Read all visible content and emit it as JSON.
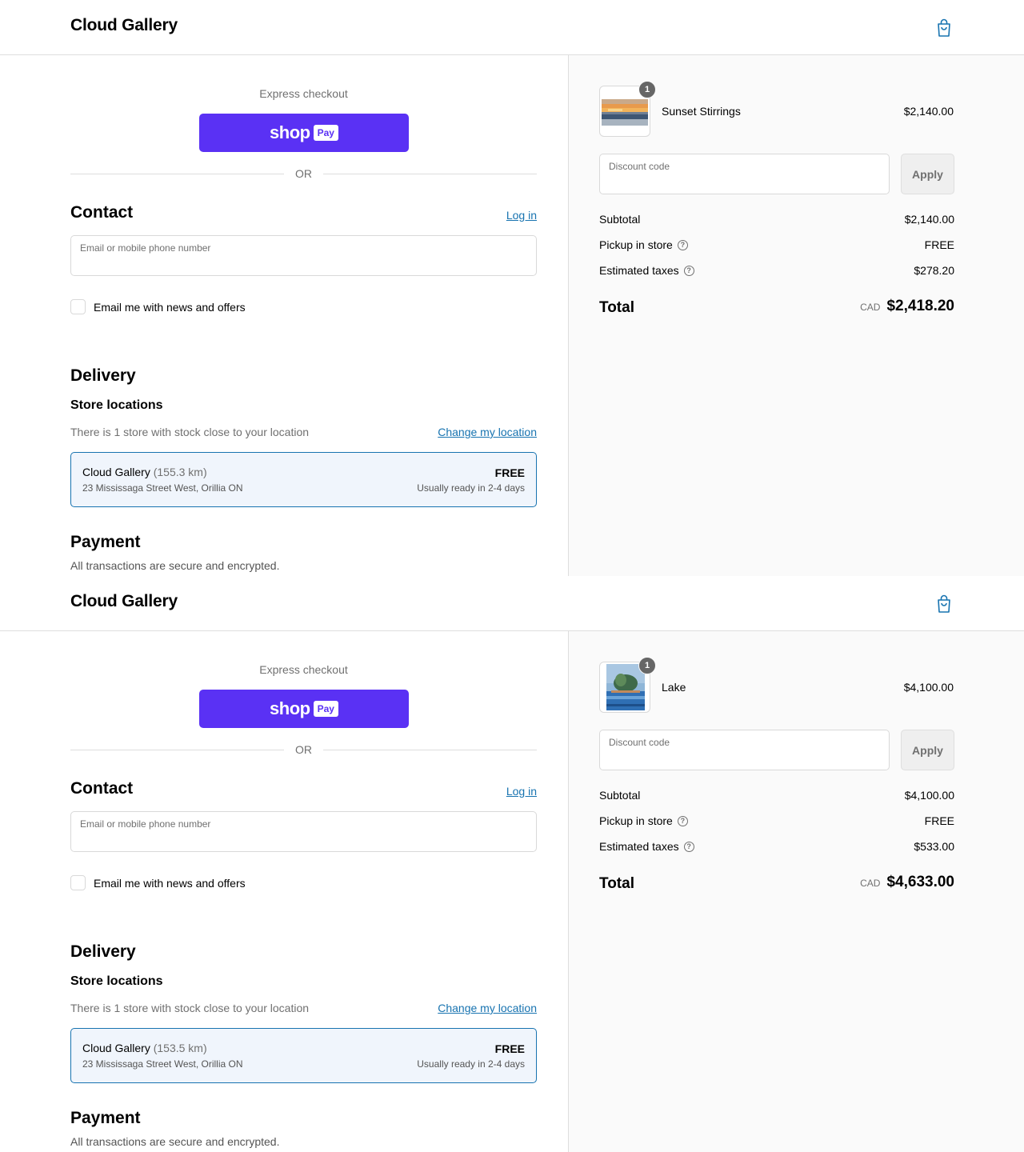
{
  "frames": [
    {
      "brand": "Cloud Gallery",
      "express_label": "Express checkout",
      "shop_word": "shop",
      "shop_pay": "Pay",
      "or_text": "OR",
      "contact": {
        "title": "Contact",
        "login_link": "Log in",
        "email_label": "Email or mobile phone number",
        "email_value": "",
        "newsletter_label": "Email me with news and offers",
        "newsletter_checked": false
      },
      "delivery": {
        "title": "Delivery",
        "subtitle": "Store locations",
        "stock_note": "There is 1 store with stock close to your location",
        "change_location": "Change my location",
        "store": {
          "name": "Cloud Gallery",
          "distance": "(155.3 km)",
          "address": "23 Mississaga Street West, Orillia ON",
          "price": "FREE",
          "ready": "Usually ready in 2-4 days"
        }
      },
      "payment": {
        "title": "Payment",
        "note": "All transactions are secure and encrypted."
      },
      "summary": {
        "item_name": "Sunset Stirrings",
        "item_qty": "1",
        "item_price": "$2,140.00",
        "discount_label": "Discount code",
        "apply_label": "Apply",
        "subtotal_label": "Subtotal",
        "subtotal_value": "$2,140.00",
        "pickup_label": "Pickup in store",
        "pickup_value": "FREE",
        "taxes_label": "Estimated taxes",
        "taxes_value": "$278.20",
        "total_label": "Total",
        "currency": "CAD",
        "total_value": "$2,418.20"
      }
    },
    {
      "brand": "Cloud Gallery",
      "express_label": "Express checkout",
      "shop_word": "shop",
      "shop_pay": "Pay",
      "or_text": "OR",
      "contact": {
        "title": "Contact",
        "login_link": "Log in",
        "email_label": "Email or mobile phone number",
        "email_value": "",
        "newsletter_label": "Email me with news and offers",
        "newsletter_checked": false
      },
      "delivery": {
        "title": "Delivery",
        "subtitle": "Store locations",
        "stock_note": "There is 1 store with stock close to your location",
        "change_location": "Change my location",
        "store": {
          "name": "Cloud Gallery",
          "distance": "(153.5 km)",
          "address": "23 Mississaga Street West, Orillia ON",
          "price": "FREE",
          "ready": "Usually ready in 2-4 days"
        }
      },
      "payment": {
        "title": "Payment",
        "note": "All transactions are secure and encrypted."
      },
      "summary": {
        "item_name": "Lake",
        "item_qty": "1",
        "item_price": "$4,100.00",
        "discount_label": "Discount code",
        "apply_label": "Apply",
        "subtotal_label": "Subtotal",
        "subtotal_value": "$4,100.00",
        "pickup_label": "Pickup in store",
        "pickup_value": "FREE",
        "taxes_label": "Estimated taxes",
        "taxes_value": "$533.00",
        "total_label": "Total",
        "currency": "CAD",
        "total_value": "$4,633.00"
      }
    }
  ],
  "icons": {
    "cart": "shopping-bag-icon",
    "help": "question-circle-icon",
    "artwork_1": "sunset-painting-thumbnail",
    "artwork_2": "lake-painting-thumbnail"
  },
  "colors": {
    "accent": "#1773b0",
    "shop_pay": "#5a31f4",
    "sidebar_bg": "#fafafa",
    "store_card_bg": "#f0f5fc"
  }
}
